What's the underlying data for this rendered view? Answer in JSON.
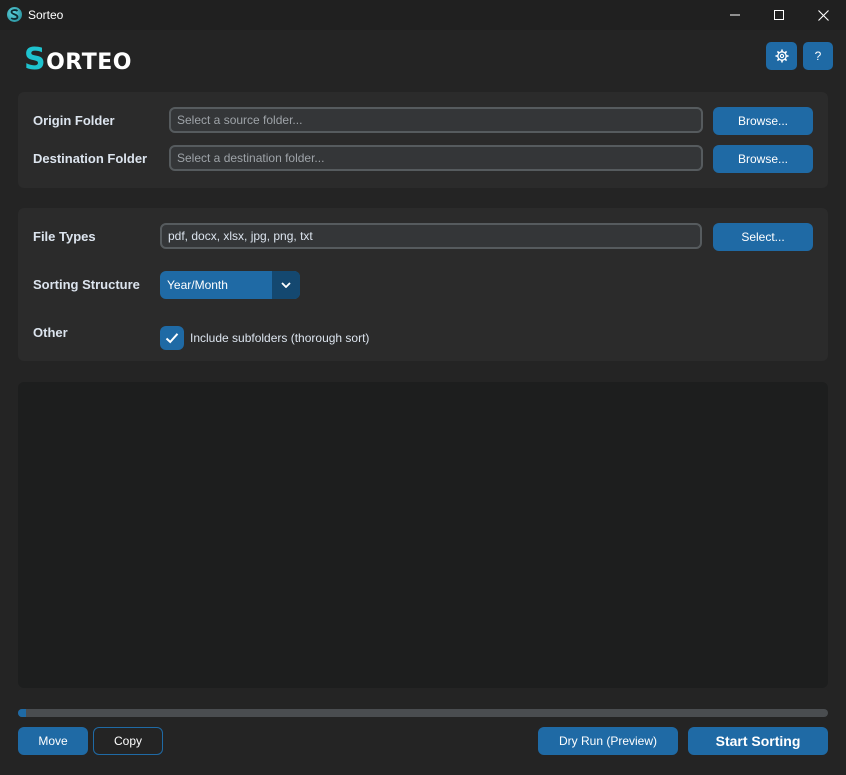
{
  "window": {
    "title": "Sorteo"
  },
  "header": {
    "logo_initial": "S",
    "logo_rest": "ORTEO",
    "help_label": "?"
  },
  "origin": {
    "label": "Origin Folder",
    "value": "",
    "placeholder": "Select a source folder...",
    "browse_label": "Browse..."
  },
  "destination": {
    "label": "Destination Folder",
    "value": "",
    "placeholder": "Select a destination folder...",
    "browse_label": "Browse..."
  },
  "file_types": {
    "label": "File Types",
    "value": "pdf, docx, xlsx, jpg, png, txt",
    "select_label": "Select..."
  },
  "sorting": {
    "label": "Sorting Structure",
    "selected": "Year/Month"
  },
  "other": {
    "label": "Other",
    "checkbox_label": "Include subfolders (thorough sort)",
    "checked": true
  },
  "log": {
    "text": ""
  },
  "progress": {
    "value": 0.01
  },
  "footer": {
    "move_label": "Move",
    "copy_label": "Copy",
    "dry_run_label": "Dry Run (Preview)",
    "start_label": "Start Sorting"
  },
  "colors": {
    "accent": "#1f6aa5",
    "accent_dark": "#144870",
    "logo_accent": "#1ec3cf",
    "background": "#242424",
    "panel": "#2b2b2b"
  },
  "icons": [
    "app-icon",
    "minimize-icon",
    "maximize-icon",
    "close-icon",
    "gear-icon",
    "chevron-down-icon",
    "checkmark-icon"
  ]
}
